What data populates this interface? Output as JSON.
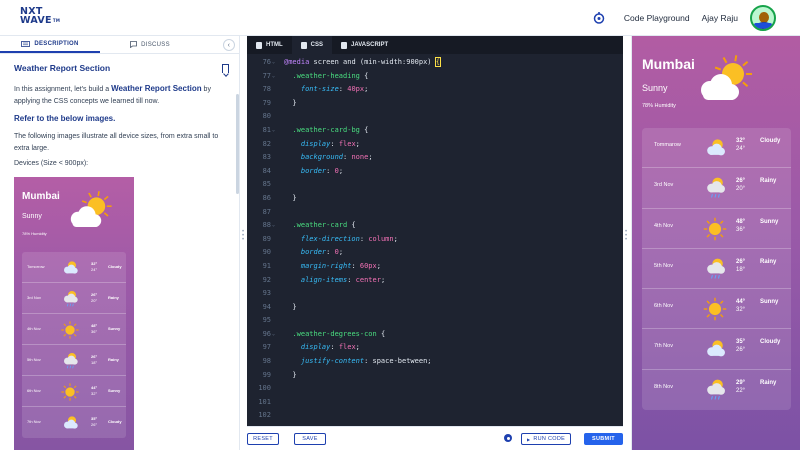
{
  "brand": {
    "logo_line1": "NXT",
    "logo_line2": "WAVE",
    "logo_tm": "TM"
  },
  "header": {
    "code_playground": "Code Playground",
    "user_name": "Ajay Raju"
  },
  "left_tabs": {
    "description": "DESCRIPTION",
    "discuss": "DISCUSS"
  },
  "description": {
    "title": "Weather Report Section",
    "intro_before": "In this assignment, let's build a ",
    "intro_bold": "Weather Report Section",
    "intro_after": " by applying the CSS concepts we learned till now.",
    "refer": "Refer to the below images.",
    "para2": "The following images illustrate all device sizes, from extra small to extra large.",
    "devices": "Devices (Size < 900px):"
  },
  "editor_tabs": {
    "html": "HTML",
    "css": "CSS",
    "js": "JAVASCRIPT"
  },
  "code_lines": [
    {
      "n": "76",
      "fold": true,
      "html": "<span style=\"color:#c084fc\">@media</span> screen and (min-width:900px) <span style=\"color:#fde047;outline:1px solid #fde047\">{</span>"
    },
    {
      "n": "77",
      "fold": true,
      "html": "  <span style=\"color:#4ade80\">.weather-heading</span> {"
    },
    {
      "n": "78",
      "fold": false,
      "html": "    <span style=\"color:#38bdf8;font-style:italic\">font-size</span>: <span style=\"color:#f472b6\">40px</span>;"
    },
    {
      "n": "79",
      "fold": false,
      "html": "  }"
    },
    {
      "n": "80",
      "fold": false,
      "html": ""
    },
    {
      "n": "81",
      "fold": true,
      "html": "  <span style=\"color:#4ade80\">.weather-card-bg</span> {"
    },
    {
      "n": "82",
      "fold": false,
      "html": "    <span style=\"color:#38bdf8;font-style:italic\">display</span>: <span style=\"color:#f472b6\">flex</span>;"
    },
    {
      "n": "83",
      "fold": false,
      "html": "    <span style=\"color:#38bdf8;font-style:italic\">background</span>: <span style=\"color:#f472b6\">none</span>;"
    },
    {
      "n": "84",
      "fold": false,
      "html": "    <span style=\"color:#38bdf8;font-style:italic\">border</span>: <span style=\"color:#f472b6\">0</span>;"
    },
    {
      "n": "85",
      "fold": false,
      "html": ""
    },
    {
      "n": "86",
      "fold": false,
      "html": "  }"
    },
    {
      "n": "87",
      "fold": false,
      "html": ""
    },
    {
      "n": "88",
      "fold": true,
      "html": "  <span style=\"color:#4ade80\">.weather-card</span> {"
    },
    {
      "n": "89",
      "fold": false,
      "html": "    <span style=\"color:#38bdf8;font-style:italic\">flex-direction</span>: <span style=\"color:#f472b6\">column</span>;"
    },
    {
      "n": "90",
      "fold": false,
      "html": "    <span style=\"color:#38bdf8;font-style:italic\">border</span>: <span style=\"color:#f472b6\">0</span>;"
    },
    {
      "n": "91",
      "fold": false,
      "html": "    <span style=\"color:#38bdf8;font-style:italic\">margin-right</span>: <span style=\"color:#f472b6\">60px</span>;"
    },
    {
      "n": "92",
      "fold": false,
      "html": "    <span style=\"color:#38bdf8;font-style:italic\">align-items</span>: <span style=\"color:#f472b6\">center</span>;"
    },
    {
      "n": "93",
      "fold": false,
      "html": ""
    },
    {
      "n": "94",
      "fold": false,
      "html": "  }"
    },
    {
      "n": "95",
      "fold": false,
      "html": ""
    },
    {
      "n": "96",
      "fold": true,
      "html": "  <span style=\"color:#4ade80\">.weather-degrees-con</span> {"
    },
    {
      "n": "97",
      "fold": false,
      "html": "    <span style=\"color:#38bdf8;font-style:italic\">display</span>: <span style=\"color:#f472b6\">flex</span>;"
    },
    {
      "n": "98",
      "fold": false,
      "html": "    <span style=\"color:#38bdf8;font-style:italic\">justify-content</span>: space-between;"
    },
    {
      "n": "99",
      "fold": false,
      "html": "  }"
    },
    {
      "n": "100",
      "fold": false,
      "html": ""
    },
    {
      "n": "101",
      "fold": false,
      "html": ""
    },
    {
      "n": "102",
      "fold": false,
      "html": ""
    }
  ],
  "buttons": {
    "reset": "RESET",
    "save": "SAVE",
    "run": "RUN CODE",
    "run_icon": "play-icon",
    "submit": "SUBMIT"
  },
  "output": {
    "city": "Mumbai",
    "condition": "Sunny",
    "humidity": "78% Humidity",
    "rows": [
      {
        "day": "Tommarow",
        "icon": "cloud",
        "high": "32°",
        "low": "24°",
        "cond": "Cloudy"
      },
      {
        "day": "3rd Nov",
        "icon": "rain",
        "high": "26°",
        "low": "20°",
        "cond": "Rainy"
      },
      {
        "day": "4th Nov",
        "icon": "sun",
        "high": "48°",
        "low": "36°",
        "cond": "Sunny"
      },
      {
        "day": "5th Nov",
        "icon": "rain",
        "high": "26°",
        "low": "18°",
        "cond": "Rainy"
      },
      {
        "day": "6th Nov",
        "icon": "sun",
        "high": "44°",
        "low": "32°",
        "cond": "Sunny"
      },
      {
        "day": "7th Nov",
        "icon": "cloud",
        "high": "35°",
        "low": "26°",
        "cond": "Cloudy"
      },
      {
        "day": "8th Nov",
        "icon": "rain",
        "high": "29°",
        "low": "22°",
        "cond": "Rainy"
      }
    ]
  },
  "preview": {
    "city": "Mumbai",
    "condition": "Sunny",
    "humidity": "78% Humidity",
    "rows": [
      {
        "day": "Tomorrow",
        "icon": "cloud",
        "high": "32°",
        "low": "24°",
        "cond": "Cloudy"
      },
      {
        "day": "3rd Nov",
        "icon": "rain",
        "high": "26°",
        "low": "20°",
        "cond": "Rainy"
      },
      {
        "day": "4th Nov",
        "icon": "sun",
        "high": "48°",
        "low": "36°",
        "cond": "Sunny"
      },
      {
        "day": "5th Nov",
        "icon": "rain",
        "high": "26°",
        "low": "18°",
        "cond": "Rainy"
      },
      {
        "day": "6th Nov",
        "icon": "sun",
        "high": "44°",
        "low": "32°",
        "cond": "Sunny"
      },
      {
        "day": "7th Nov",
        "icon": "cloud",
        "high": "35°",
        "low": "26°",
        "cond": "Cloudy"
      }
    ]
  },
  "colors": {
    "brand": "#1e3a8a",
    "accent": "#2563eb",
    "editor_bg": "#1e2330",
    "gradient_top": "#b25ca3",
    "gradient_bottom": "#7c52a5"
  }
}
